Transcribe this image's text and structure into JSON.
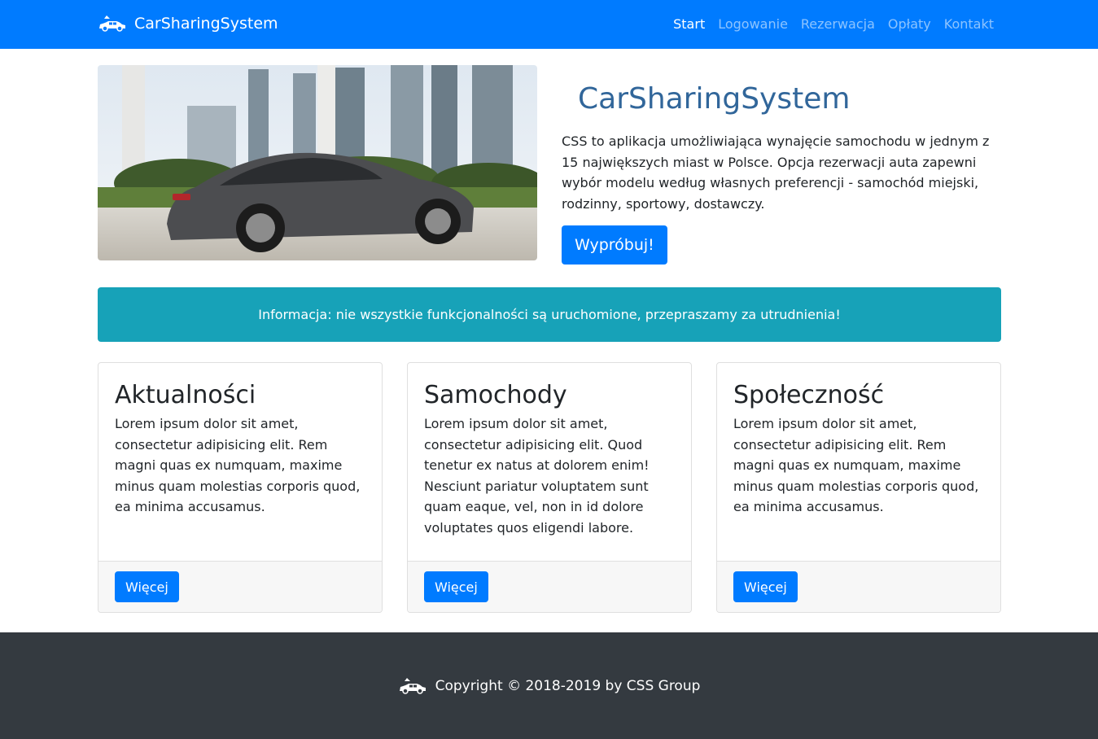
{
  "navbar": {
    "brand": "CarSharingSystem",
    "brand_icon": "car-icon",
    "links": [
      "Start",
      "Logowanie",
      "Rezerwacja",
      "Opłaty",
      "Kontakt"
    ],
    "active": "Start",
    "color": "#007bff"
  },
  "hero": {
    "image": "car-photo",
    "title": "CarSharingSystem",
    "description": "CSS to aplikacja umożliwiająca wynajęcie samochodu w jednym z 15 największych miast w Polsce. Opcja rezerwacji auta zapewni wybór modelu według własnych preferencji - samochód miejski, rodzinny, sportowy, dostawczy.",
    "button": "Wypróbuj!"
  },
  "alert": {
    "text": "Informacja: nie wszystkie funkcjonalności są uruchomione, przepraszamy za utrudnienia!",
    "color": "#17a2b8"
  },
  "cards": [
    {
      "title": "Aktualności",
      "text": "Lorem ipsum dolor sit amet, consectetur adipisicing elit. Rem magni quas ex numquam, maxime minus quam molestias corporis quod, ea minima accusamus.",
      "button": "Więcej"
    },
    {
      "title": "Samochody",
      "text": "Lorem ipsum dolor sit amet, consectetur adipisicing elit. Quod tenetur ex natus at dolorem enim! Nesciunt pariatur voluptatem sunt quam eaque, vel, non in id dolore voluptates quos eligendi labore.",
      "button": "Więcej"
    },
    {
      "title": "Społeczność",
      "text": "Lorem ipsum dolor sit amet, consectetur adipisicing elit. Rem magni quas ex numquam, maxime minus quam molestias corporis quod, ea minima accusamus.",
      "button": "Więcej"
    }
  ],
  "footer": {
    "text": "Copyright © 2018-2019 by CSS Group",
    "icon": "car-icon",
    "color": "#343a40"
  }
}
